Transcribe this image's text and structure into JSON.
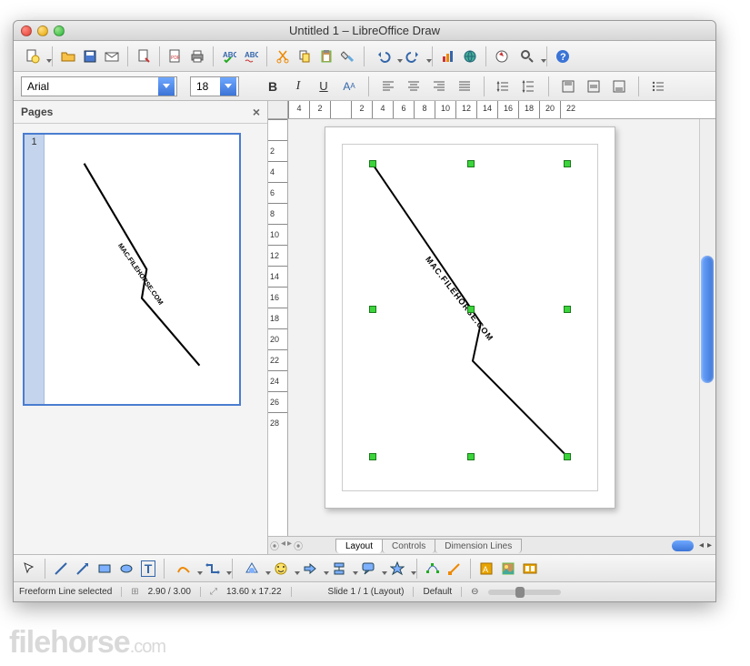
{
  "window": {
    "title": "Untitled 1 – LibreOffice Draw"
  },
  "format": {
    "font": "Arial",
    "size": "18"
  },
  "pages_panel": {
    "title": "Pages",
    "page_number": "1"
  },
  "ruler": {
    "h": [
      "4",
      "2",
      "",
      "2",
      "4",
      "6",
      "8",
      "10",
      "12",
      "14",
      "16",
      "18",
      "20",
      "22"
    ],
    "v": [
      "",
      "2",
      "4",
      "6",
      "8",
      "10",
      "12",
      "14",
      "16",
      "18",
      "20",
      "22",
      "24",
      "26",
      "28"
    ]
  },
  "tabs": {
    "layout": "Layout",
    "controls": "Controls",
    "dimension": "Dimension Lines"
  },
  "status": {
    "selection": "Freeform Line selected",
    "pos": "2.90 / 3.00",
    "size": "13.60 x 17.22",
    "slide": "Slide 1 / 1 (Layout)",
    "tpl": "Default"
  },
  "drawing_label": "MAC.FILEHORSE.COM",
  "watermark": {
    "brand": "filehorse",
    "domain": ".com"
  }
}
